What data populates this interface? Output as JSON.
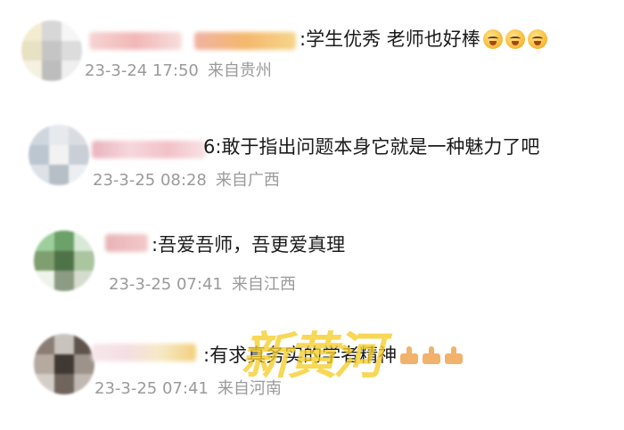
{
  "comments": [
    {
      "text": ":学生优秀 老师也好棒",
      "reaction_icons": [
        "scream-face-emoji",
        "scream-face-emoji",
        "scream-face-emoji"
      ],
      "date": "23-3-24 17:50",
      "location": "来自贵州"
    },
    {
      "text": "6:敢于指出问题本身它就是一种魅力了吧",
      "reaction_icons": [],
      "date": "23-3-25 08:28",
      "location": "来自广西"
    },
    {
      "text": ":吾爱吾师，吾更爱真理",
      "reaction_icons": [],
      "date": "23-3-25 07:41",
      "location": "来自江西"
    },
    {
      "text": ":有求真务实的学者精神",
      "reaction_icons": [
        "thumbs-up-emoji",
        "thumbs-up-emoji",
        "thumbs-up-emoji"
      ],
      "date": "23-3-25 07:41",
      "location": "来自河南"
    }
  ],
  "watermark": "新黄河",
  "colors": {
    "text": "#1a1a1a",
    "meta": "#9a9a9a",
    "watermark": "#f5cd28"
  }
}
